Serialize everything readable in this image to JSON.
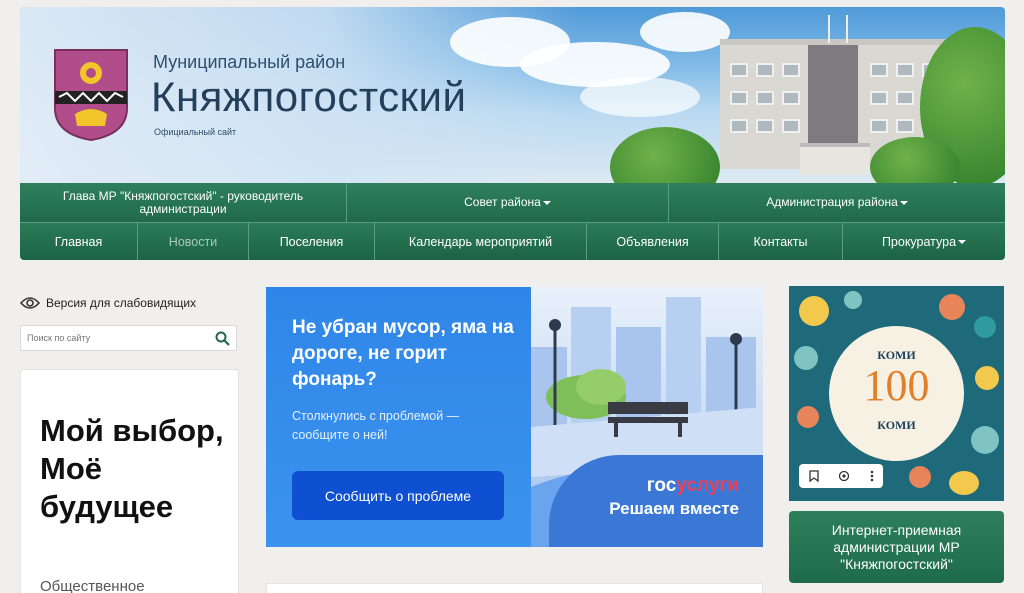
{
  "header": {
    "subtitle": "Муниципальный район",
    "title": "Княжпогостский",
    "tagline": "Официальный сайт"
  },
  "nav_primary": [
    {
      "label": "Глава МР \"Княжпогостский\" - руководитель администрации",
      "dropdown": false
    },
    {
      "label": "Совет района",
      "dropdown": true
    },
    {
      "label": "Администрация района",
      "dropdown": true
    }
  ],
  "nav_secondary": [
    {
      "label": "Главная",
      "active": false,
      "dropdown": false
    },
    {
      "label": "Новости",
      "active": true,
      "dropdown": false
    },
    {
      "label": "Поселения",
      "active": false,
      "dropdown": false
    },
    {
      "label": "Календарь мероприятий",
      "active": false,
      "dropdown": false
    },
    {
      "label": "Объявления",
      "active": false,
      "dropdown": false
    },
    {
      "label": "Контакты",
      "active": false,
      "dropdown": false
    },
    {
      "label": "Прокуратура",
      "active": false,
      "dropdown": true
    }
  ],
  "sidebar": {
    "vision_label": "Версия для слабовидящих",
    "search_placeholder": "Поиск по сайту",
    "card_big": "Мой выбор, Моё будущее",
    "card_small": "Общественное"
  },
  "banner": {
    "heading": "Не убран мусор, яма на дороге, не горит фонарь?",
    "text": "Столкнулись с проблемой — сообщите о ней!",
    "button": "Сообщить о проблеме",
    "brand_a": "гос",
    "brand_b": "услуги",
    "motto": "Решаем вместе"
  },
  "poster": {
    "top": "КОМИ",
    "number": "100",
    "bottom": "КОМИ"
  },
  "reception": {
    "label": "Интернет-приемная администрации МР \"Княжпогостский\""
  },
  "colors": {
    "nav_green": "#1f6a4b",
    "banner_blue": "#2f86e8",
    "button_blue": "#0f4fd1",
    "gos_red": "#ee3f58"
  }
}
